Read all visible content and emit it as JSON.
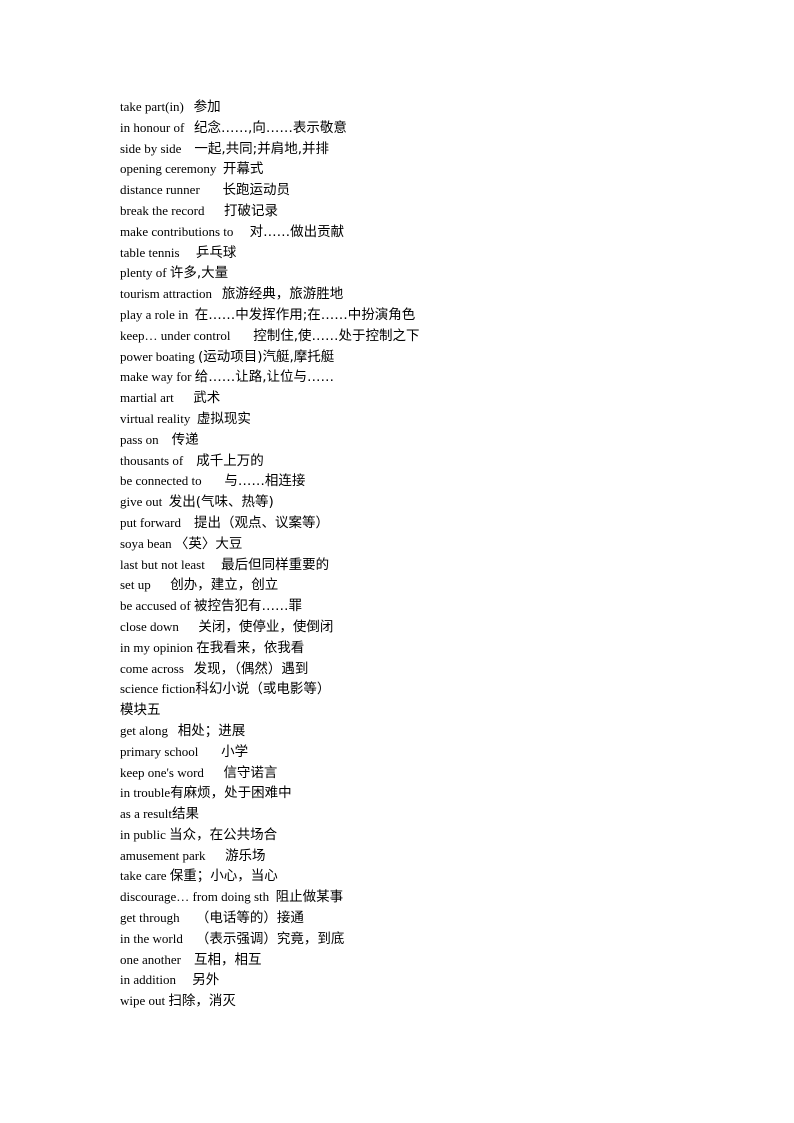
{
  "document": {
    "lines": [
      {
        "en": "take part(in)",
        "gap": "   ",
        "zh": "参加"
      },
      {
        "en": "in honour of",
        "gap": "   ",
        "zh": "纪念……,向……表示敬意"
      },
      {
        "en": "side by side",
        "gap": "    ",
        "zh": "一起,共同;并肩地,并排"
      },
      {
        "en": "opening ceremony",
        "gap": "  ",
        "zh": "开幕式"
      },
      {
        "en": "distance runner",
        "gap": "       ",
        "zh": "长跑运动员"
      },
      {
        "en": "break the record",
        "gap": "      ",
        "zh": "打破记录"
      },
      {
        "en": "make contributions to",
        "gap": "     ",
        "zh": "对……做出贡献"
      },
      {
        "en": "table tennis",
        "gap": "     ",
        "zh": "乒乓球"
      },
      {
        "en": "plenty of",
        "gap": " ",
        "zh": "许多,大量"
      },
      {
        "en": "tourism attraction",
        "gap": "   ",
        "zh": "旅游经典，旅游胜地"
      },
      {
        "en": "play a role in",
        "gap": "  ",
        "zh": "在……中发挥作用;在……中扮演角色"
      },
      {
        "en": "keep… under control",
        "gap": "       ",
        "zh": "控制住,使……处于控制之下"
      },
      {
        "en": "power boating",
        "gap": " ",
        "zh": "(运动项目)汽艇,摩托艇"
      },
      {
        "en": "make way for",
        "gap": " ",
        "zh": "给……让路,让位与……"
      },
      {
        "en": "martial art",
        "gap": "      ",
        "zh": "武术"
      },
      {
        "en": "virtual reality",
        "gap": "  ",
        "zh": "虚拟现实"
      },
      {
        "en": "pass on",
        "gap": "    ",
        "zh": "传递"
      },
      {
        "en": "thousants of",
        "gap": "    ",
        "zh": "成千上万的"
      },
      {
        "en": "be connected to",
        "gap": "       ",
        "zh": "与……相连接"
      },
      {
        "en": "give out",
        "gap": "  ",
        "zh": "发出(气味、热等)"
      },
      {
        "en": "put forward",
        "gap": "    ",
        "zh": "提出（观点、议案等）"
      },
      {
        "en": "soya bean",
        "gap": " ",
        "zh": "〈英〉大豆"
      },
      {
        "en": "last but not least",
        "gap": "     ",
        "zh": "最后但同样重要的"
      },
      {
        "en": "set up",
        "gap": "      ",
        "zh": "创办，建立，创立"
      },
      {
        "en": "be accused of",
        "gap": " ",
        "zh": "被控告犯有……罪"
      },
      {
        "en": "close down",
        "gap": "      ",
        "zh": "关闭，使停业，使倒闭"
      },
      {
        "en": "in my opinion",
        "gap": " ",
        "zh": "在我看来，依我看"
      },
      {
        "en": "come across",
        "gap": "   ",
        "zh": "发现，（偶然）遇到"
      },
      {
        "en": "science fiction",
        "gap": "",
        "zh": "科幻小说（或电影等）"
      },
      {
        "en": "",
        "gap": "",
        "zh": "",
        "heading": "模块五"
      },
      {
        "en": "get along",
        "gap": "   ",
        "zh": "相处；进展"
      },
      {
        "en": "primary school",
        "gap": "       ",
        "zh": "小学"
      },
      {
        "en": "keep one's word",
        "gap": "      ",
        "zh": "信守诺言"
      },
      {
        "en": "in trouble",
        "gap": "",
        "zh": "有麻烦，处于困难中"
      },
      {
        "en": "as a result",
        "gap": "",
        "zh": "结果"
      },
      {
        "en": "in public",
        "gap": " ",
        "zh": "当众，在公共场合"
      },
      {
        "en": "amusement park",
        "gap": "      ",
        "zh": "游乐场"
      },
      {
        "en": "take care",
        "gap": " ",
        "zh": "保重；小心，当心"
      },
      {
        "en": "discourage… from doing sth",
        "gap": "  ",
        "zh": "阻止做某事"
      },
      {
        "en": "get through",
        "gap": "     ",
        "zh": "（电话等的）接通"
      },
      {
        "en": "in the world",
        "gap": "    ",
        "zh": "（表示强调）究竟，到底"
      },
      {
        "en": "one another",
        "gap": "    ",
        "zh": "互相，相互"
      },
      {
        "en": "in addition",
        "gap": "     ",
        "zh": "另外"
      },
      {
        "en": "wipe out",
        "gap": " ",
        "zh": "扫除，消灭"
      }
    ]
  }
}
